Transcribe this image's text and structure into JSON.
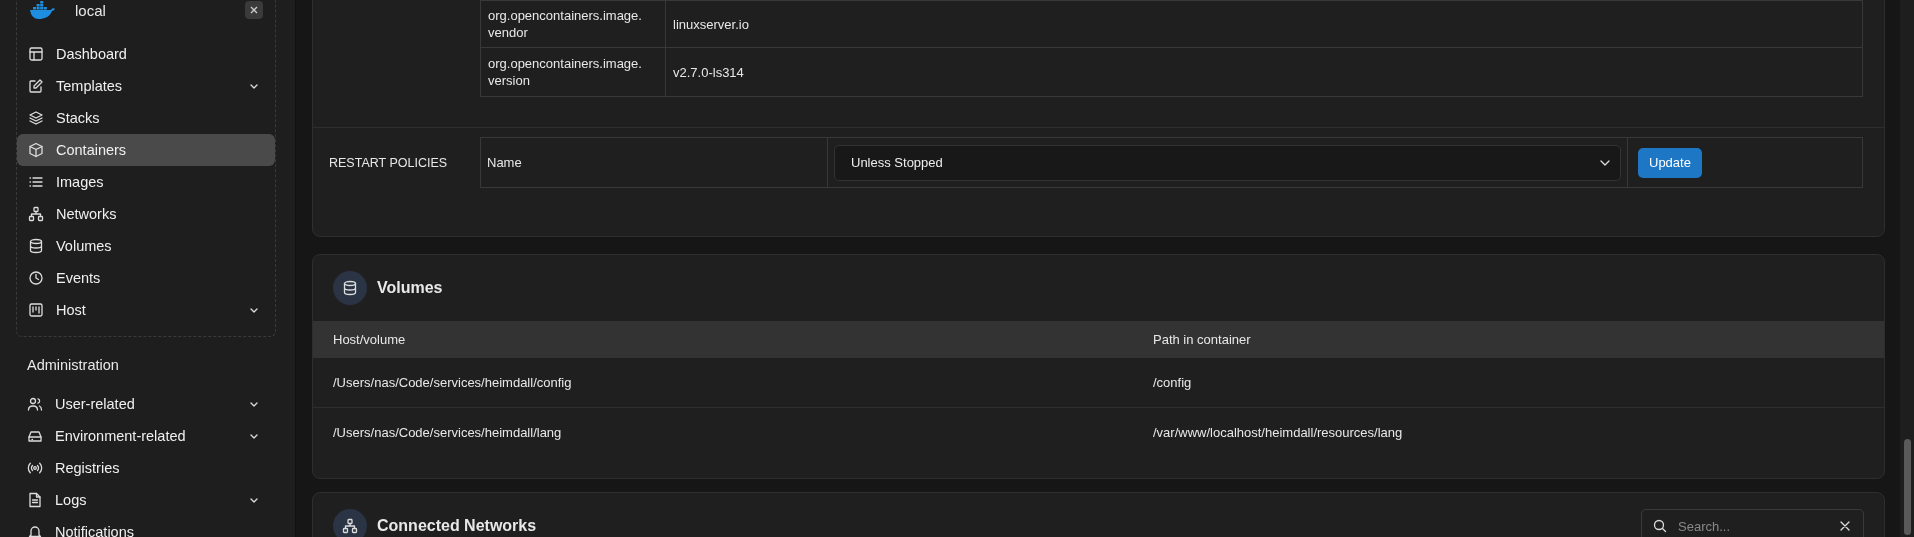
{
  "sidebar": {
    "environment": {
      "name": "local"
    },
    "items": [
      {
        "label": "Dashboard",
        "expandable": false,
        "selected": false
      },
      {
        "label": "Templates",
        "expandable": true,
        "selected": false
      },
      {
        "label": "Stacks",
        "expandable": false,
        "selected": false
      },
      {
        "label": "Containers",
        "expandable": false,
        "selected": true
      },
      {
        "label": "Images",
        "expandable": false,
        "selected": false
      },
      {
        "label": "Networks",
        "expandable": false,
        "selected": false
      },
      {
        "label": "Volumes",
        "expandable": false,
        "selected": false
      },
      {
        "label": "Events",
        "expandable": false,
        "selected": false
      },
      {
        "label": "Host",
        "expandable": true,
        "selected": false
      }
    ],
    "section_title": "Administration",
    "admin_items": [
      {
        "label": "User-related",
        "expandable": true,
        "selected": false
      },
      {
        "label": "Environment-related",
        "expandable": true,
        "selected": false
      },
      {
        "label": "Registries",
        "expandable": false,
        "selected": false
      },
      {
        "label": "Logs",
        "expandable": true,
        "selected": false
      },
      {
        "label": "Notifications",
        "expandable": false,
        "selected": false
      }
    ]
  },
  "container_details": {
    "labels": [
      {
        "key": "org.opencontainers.image.vendor",
        "value": "linuxserver.io"
      },
      {
        "key": "org.opencontainers.image.version",
        "value": "v2.7.0-ls314"
      }
    ],
    "restart_policies": {
      "label": "RESTART POLICIES",
      "field_label": "Name",
      "value": "Unless Stopped",
      "button": "Update"
    }
  },
  "volumes": {
    "title": "Volumes",
    "columns": [
      "Host/volume",
      "Path in container"
    ],
    "rows": [
      [
        "/Users/nas/Code/services/heimdall/config",
        "/config"
      ],
      [
        "/Users/nas/Code/services/heimdall/lang",
        "/var/www/localhost/heimdall/resources/lang"
      ]
    ]
  },
  "connected_networks": {
    "title": "Connected Networks",
    "search": {
      "placeholder": "Search..."
    }
  }
}
